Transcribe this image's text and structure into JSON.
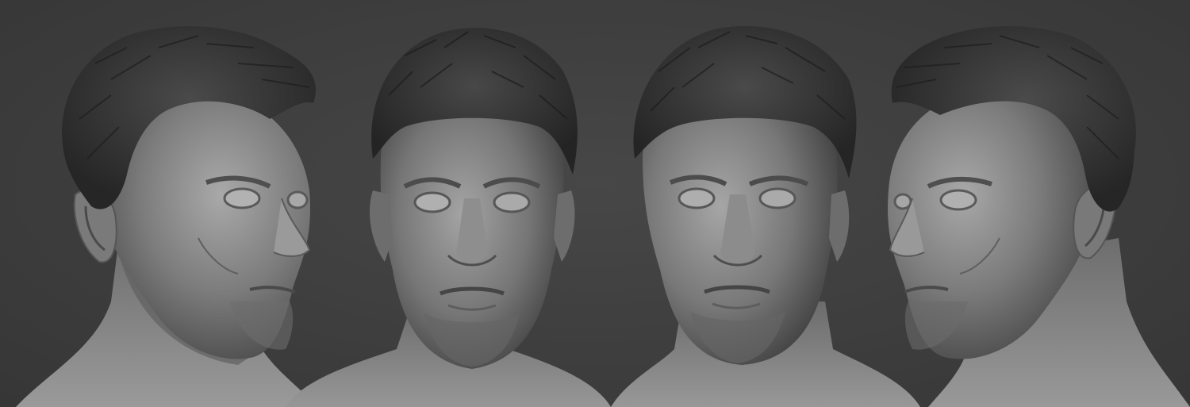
{
  "scene": {
    "background_color": "#3f3f3f",
    "clay_color": "#8a8a8a",
    "hair_color": "#2e2e2e",
    "views": [
      {
        "name": "three-quarter-right",
        "icon": "sculpt-head-three-quarter-right"
      },
      {
        "name": "front-lit-left",
        "icon": "sculpt-head-front"
      },
      {
        "name": "front-lit-right",
        "icon": "sculpt-head-front-alt"
      },
      {
        "name": "three-quarter-left",
        "icon": "sculpt-head-three-quarter-left"
      }
    ]
  }
}
